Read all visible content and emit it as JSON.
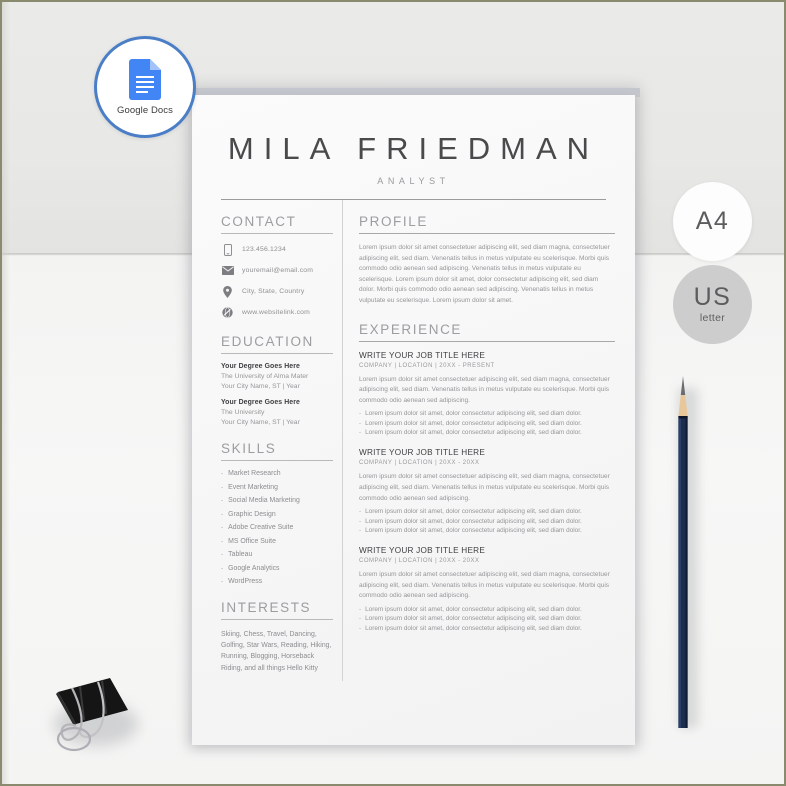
{
  "badges": {
    "google_docs": {
      "label": "Google Docs",
      "icon": "google-docs-icon",
      "ring_color": "#4a7ec7",
      "doc_color": "#4285f4"
    },
    "a4": {
      "main": "A4",
      "sub": ""
    },
    "us": {
      "main": "US",
      "sub": "letter"
    }
  },
  "resume": {
    "name": "MILA FRIEDMAN",
    "role": "ANALYST",
    "contact": {
      "heading": "CONTACT",
      "items": [
        {
          "icon": "phone-icon",
          "text": "123.456.1234"
        },
        {
          "icon": "envelope-icon",
          "text": "youremail@email.com"
        },
        {
          "icon": "location-pin-icon",
          "text": "City, State, Country"
        },
        {
          "icon": "globe-icon",
          "text": "www.websitelink.com"
        }
      ]
    },
    "education": {
      "heading": "EDUCATION",
      "items": [
        {
          "degree": "Your Degree Goes Here",
          "school": "The University of Alma Mater",
          "detail": "Your City Name, ST  |  Year"
        },
        {
          "degree": "Your Degree Goes Here",
          "school": "The University",
          "detail": "Your City Name, ST  |  Year"
        }
      ]
    },
    "skills": {
      "heading": "SKILLS",
      "items": [
        "Market Research",
        "Event Marketing",
        "Social Media Marketing",
        "Graphic Design",
        "Adobe Creative Suite",
        "MS Office Suite",
        "Tableau",
        "Google Analytics",
        "WordPress"
      ]
    },
    "interests": {
      "heading": "INTERESTS",
      "text": "Skiing, Chess, Travel, Dancing, Golfing, Star Wars, Reading, Hiking, Running, Blogging, Horseback Riding, and all things Hello Kitty"
    },
    "profile": {
      "heading": "PROFILE",
      "text": "Lorem ipsum dolor sit amet consectetuer adipiscing elit, sed diam magna, consectetuer adipiscing elit, sed diam. Venenatis tellus in metus vulputate eu scelerisque. Morbi quis commodo odio aenean sed adipiscing. Venenatis tellus in metus vulputate eu scelerisque. Lorem ipsum dolor sit amet, dolor consectetur adipiscing elit, sed diam dolor. Morbi quis commodo odio aenean sed adipiscing. Venenatis tellus in metus vulputate eu scelerisque. Lorem ipsum dolor sit amet."
    },
    "experience": {
      "heading": "EXPERIENCE",
      "jobs": [
        {
          "title": "WRITE YOUR JOB TITLE HERE",
          "meta": "COMPANY  |  LOCATION  |  20XX - PRESENT",
          "summary": "Lorem ipsum dolor sit amet consectetuer adipiscing elit, sed diam magna, consectetuer adipiscing elit, sed diam. Venenatis tellus in metus vulputate eu scelerisque. Morbi quis commodo odio aenean sed adipiscing.",
          "bullets": [
            "Lorem ipsum dolor sit amet, dolor consectetur adipiscing elit, sed diam dolor.",
            "Lorem ipsum dolor sit amet, dolor consectetur adipiscing elit, sed diam dolor.",
            "Lorem ipsum dolor sit amet, dolor consectetur adipiscing elit, sed diam dolor."
          ]
        },
        {
          "title": "WRITE YOUR JOB TITLE HERE",
          "meta": "COMPANY  |  LOCATION  |  20XX - 20XX",
          "summary": "Lorem ipsum dolor sit amet consectetuer adipiscing elit, sed diam magna, consectetuer adipiscing elit, sed diam. Venenatis tellus in metus vulputate eu scelerisque. Morbi quis commodo odio aenean sed adipiscing.",
          "bullets": [
            "Lorem ipsum dolor sit amet, dolor consectetur adipiscing elit, sed diam dolor.",
            "Lorem ipsum dolor sit amet, dolor consectetur adipiscing elit, sed diam dolor.",
            "Lorem ipsum dolor sit amet, dolor consectetur adipiscing elit, sed diam dolor."
          ]
        },
        {
          "title": "WRITE YOUR JOB TITLE HERE",
          "meta": "COMPANY  |  LOCATION  |  20XX - 20XX",
          "summary": "Lorem ipsum dolor sit amet consectetuer adipiscing elit, sed diam magna, consectetuer adipiscing elit, sed diam. Venenatis tellus in metus vulputate eu scelerisque. Morbi quis commodo odio aenean sed adipiscing.",
          "bullets": [
            "Lorem ipsum dolor sit amet, dolor consectetur adipiscing elit, sed diam dolor.",
            "Lorem ipsum dolor sit amet, dolor consectetur adipiscing elit, sed diam dolor.",
            "Lorem ipsum dolor sit amet, dolor consectetur adipiscing elit, sed diam dolor."
          ]
        }
      ]
    }
  },
  "props": {
    "pencil": {
      "name": "pencil",
      "body_color": "#1d2d4e",
      "wood_color": "#e8c79a",
      "tip_color": "#6b6b70"
    },
    "binder_clip": {
      "name": "binder-clip",
      "body_color": "#1a1a1a",
      "wire_color": "#b8b8bc"
    }
  }
}
